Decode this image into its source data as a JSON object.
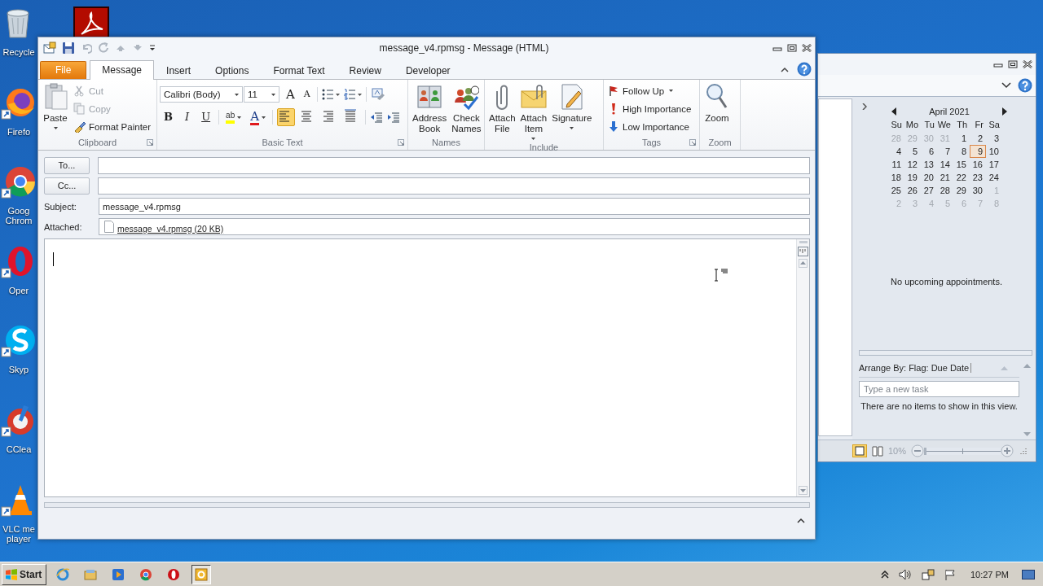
{
  "desktop": {
    "icons": [
      {
        "label": "Recycle"
      },
      {
        "label": "Firefo"
      },
      {
        "label": "Goog Chrom"
      },
      {
        "label": "Oper"
      },
      {
        "label": "Skyp"
      },
      {
        "label": "CClea"
      },
      {
        "label": "VLC me player"
      }
    ]
  },
  "message_window": {
    "title": "message_v4.rpmsg  -  Message (HTML)",
    "tabs": [
      {
        "label": "File",
        "kind": "file",
        "selected": false
      },
      {
        "label": "Message",
        "kind": "tab",
        "selected": true
      },
      {
        "label": "Insert",
        "kind": "tab",
        "selected": false
      },
      {
        "label": "Options",
        "kind": "tab",
        "selected": false
      },
      {
        "label": "Format Text",
        "kind": "tab",
        "selected": false
      },
      {
        "label": "Review",
        "kind": "tab",
        "selected": false
      },
      {
        "label": "Developer",
        "kind": "tab",
        "selected": false
      }
    ],
    "clipboard": {
      "label": "Clipboard",
      "paste": "Paste",
      "small": [
        {
          "label": "Cut",
          "disabled": true
        },
        {
          "label": "Copy",
          "disabled": true
        },
        {
          "label": "Format Painter",
          "disabled": false
        }
      ]
    },
    "basic_text": {
      "label": "Basic Text",
      "font": "Calibri (Body)",
      "size": "11",
      "grow_font": "A",
      "shrink_font": "A",
      "format": [
        {
          "label": "B"
        },
        {
          "label": "I"
        },
        {
          "label": "U"
        }
      ],
      "highlight": "ab",
      "font_color": "A",
      "alignment": [
        {
          "selected": true
        },
        {
          "selected": false
        },
        {
          "selected": false
        },
        {
          "selected": false
        }
      ]
    },
    "names": {
      "label": "Names",
      "buttons": [
        {
          "label": "Address Book"
        },
        {
          "label": "Check Names"
        }
      ]
    },
    "include": {
      "label": "Include",
      "buttons": [
        {
          "label": "Attach File",
          "dropdown": false
        },
        {
          "label": "Attach Item",
          "dropdown": true
        },
        {
          "label": "Signature",
          "dropdown": true
        }
      ]
    },
    "tags": {
      "label": "Tags",
      "items": [
        {
          "label": "Follow Up",
          "dropdown": true
        },
        {
          "label": "High Importance",
          "dropdown": false
        },
        {
          "label": "Low Importance",
          "dropdown": false
        }
      ]
    },
    "zoom": {
      "label": "Zoom",
      "button": "Zoom"
    },
    "recipients": [
      {
        "button": "To..."
      },
      {
        "button": "Cc..."
      }
    ],
    "subject": {
      "label": "Subject:",
      "value": "message_v4.rpmsg"
    },
    "attachment": {
      "label": "Attached:",
      "file": "message_v4.rpmsg (20 KB)"
    }
  },
  "outlook_window": {
    "calendar": {
      "month": "April 2021",
      "weekdays": [
        "Su",
        "Mo",
        "Tu",
        "We",
        "Th",
        "Fr",
        "Sa"
      ],
      "weeks": [
        [
          {
            "d": "28",
            "outside": true,
            "today": false
          },
          {
            "d": "29",
            "outside": true,
            "today": false
          },
          {
            "d": "30",
            "outside": true,
            "today": false
          },
          {
            "d": "31",
            "outside": true,
            "today": false
          },
          {
            "d": "1",
            "outside": false,
            "today": false
          },
          {
            "d": "2",
            "outside": false,
            "today": false
          },
          {
            "d": "3",
            "outside": false,
            "today": false
          }
        ],
        [
          {
            "d": "4",
            "outside": false,
            "today": false
          },
          {
            "d": "5",
            "outside": false,
            "today": false
          },
          {
            "d": "6",
            "outside": false,
            "today": false
          },
          {
            "d": "7",
            "outside": false,
            "today": false
          },
          {
            "d": "8",
            "outside": false,
            "today": false
          },
          {
            "d": "9",
            "outside": false,
            "today": true
          },
          {
            "d": "10",
            "outside": false,
            "today": false
          }
        ],
        [
          {
            "d": "11",
            "outside": false,
            "today": false
          },
          {
            "d": "12",
            "outside": false,
            "today": false
          },
          {
            "d": "13",
            "outside": false,
            "today": false
          },
          {
            "d": "14",
            "outside": false,
            "today": false
          },
          {
            "d": "15",
            "outside": false,
            "today": false
          },
          {
            "d": "16",
            "outside": false,
            "today": false
          },
          {
            "d": "17",
            "outside": false,
            "today": false
          }
        ],
        [
          {
            "d": "18",
            "outside": false,
            "today": false
          },
          {
            "d": "19",
            "outside": false,
            "today": false
          },
          {
            "d": "20",
            "outside": false,
            "today": false
          },
          {
            "d": "21",
            "outside": false,
            "today": false
          },
          {
            "d": "22",
            "outside": false,
            "today": false
          },
          {
            "d": "23",
            "outside": false,
            "today": false
          },
          {
            "d": "24",
            "outside": false,
            "today": false
          }
        ],
        [
          {
            "d": "25",
            "outside": false,
            "today": false
          },
          {
            "d": "26",
            "outside": false,
            "today": false
          },
          {
            "d": "27",
            "outside": false,
            "today": false
          },
          {
            "d": "28",
            "outside": false,
            "today": false
          },
          {
            "d": "29",
            "outside": false,
            "today": false
          },
          {
            "d": "30",
            "outside": false,
            "today": false
          },
          {
            "d": "1",
            "outside": true,
            "today": false
          }
        ],
        [
          {
            "d": "2",
            "outside": true,
            "today": false
          },
          {
            "d": "3",
            "outside": true,
            "today": false
          },
          {
            "d": "4",
            "outside": true,
            "today": false
          },
          {
            "d": "5",
            "outside": true,
            "today": false
          },
          {
            "d": "6",
            "outside": true,
            "today": false
          },
          {
            "d": "7",
            "outside": true,
            "today": false
          },
          {
            "d": "8",
            "outside": true,
            "today": false
          }
        ]
      ]
    },
    "appointments": "No upcoming appointments.",
    "tasks": {
      "arrange": "Arrange By: Flag: Due Date",
      "placeholder": "Type a new task",
      "empty": "There are no items to show in this view."
    },
    "zoom_level": "10%",
    "zoom_slider": {
      "level": 0
    }
  },
  "taskbar": {
    "start": "Start",
    "apps": [
      {
        "selected": false
      },
      {
        "selected": false
      },
      {
        "selected": false
      },
      {
        "selected": false
      },
      {
        "selected": false
      },
      {
        "selected": true
      }
    ],
    "time": "10:27 PM"
  }
}
